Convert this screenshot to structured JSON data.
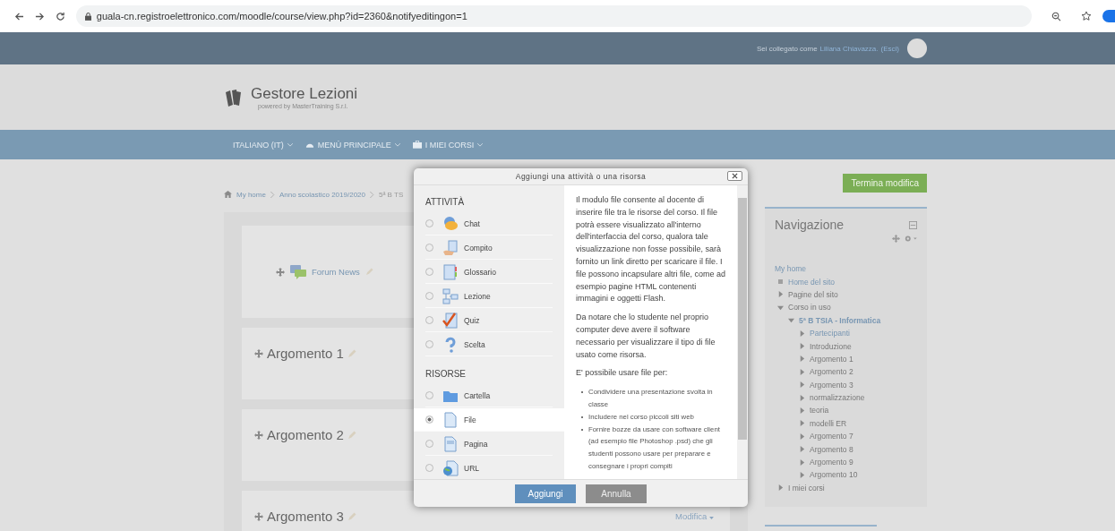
{
  "browser": {
    "url": "guala-cn.registroelettronico.com/moodle/course/view.php?id=2360&notifyeditingon=1"
  },
  "top_bar": {
    "prefix": "Sei collegato come",
    "user": "Liliana Chiavazza.",
    "logout": "(Esci)"
  },
  "logo": {
    "title": "Gestore Lezioni",
    "subtitle": "powered by MasterTraining S.r.l."
  },
  "menu": [
    {
      "kind": "language",
      "label": "ITALIANO (IT)"
    },
    {
      "kind": "dashboard",
      "label": "MENÙ PRINCIPALE"
    },
    {
      "kind": "courses",
      "label": "I MIEI CORSI"
    }
  ],
  "breadcrumb": [
    "My home",
    "Anno scolastico 2019/2020",
    "5ª B TS"
  ],
  "forum": {
    "label": "Forum News"
  },
  "sections": [
    {
      "title": "Argomento 1"
    },
    {
      "title": "Argomento 2"
    },
    {
      "title": "Argomento 3",
      "edit_menu": "Modifica"
    }
  ],
  "edit_button": "Termina modifica",
  "navigation": {
    "title": "Navigazione",
    "tree": [
      {
        "label": "My home",
        "link": true,
        "children": [
          {
            "label": "Home del sito",
            "link": true
          },
          {
            "label": "Pagine del sito",
            "link": false,
            "expanded": false
          },
          {
            "label": "Corso in uso",
            "link": false,
            "expanded": true,
            "children": [
              {
                "label": "5ª B TSIA - Informatica",
                "link": true,
                "bold": true,
                "expanded": true,
                "children": [
                  {
                    "label": "Partecipanti",
                    "link": true,
                    "expanded": false
                  },
                  {
                    "label": "Introduzione",
                    "link": false,
                    "expanded": false
                  },
                  {
                    "label": "Argomento 1",
                    "link": false,
                    "expanded": false
                  },
                  {
                    "label": "Argomento 2",
                    "link": false,
                    "expanded": false
                  },
                  {
                    "label": "Argomento 3",
                    "link": false,
                    "expanded": false
                  },
                  {
                    "label": "normalizzazione",
                    "link": false,
                    "expanded": false
                  },
                  {
                    "label": "teoria",
                    "link": false,
                    "expanded": false
                  },
                  {
                    "label": "modelli ER",
                    "link": false,
                    "expanded": false
                  },
                  {
                    "label": "Argomento 7",
                    "link": false,
                    "expanded": false
                  },
                  {
                    "label": "Argomento 8",
                    "link": false,
                    "expanded": false
                  },
                  {
                    "label": "Argomento 9",
                    "link": false,
                    "expanded": false
                  },
                  {
                    "label": "Argomento 10",
                    "link": false,
                    "expanded": false
                  }
                ]
              }
            ]
          },
          {
            "label": "I miei corsi",
            "link": false,
            "expanded": false
          }
        ]
      }
    ]
  },
  "dialog": {
    "title": "Aggiungi una attività o una risorsa",
    "groups": [
      {
        "heading": "ATTIVITÀ",
        "options": [
          {
            "kind": "chat",
            "label": "Chat",
            "selected": false
          },
          {
            "kind": "assignment",
            "label": "Compito",
            "selected": false
          },
          {
            "kind": "glossary",
            "label": "Glossario",
            "selected": false
          },
          {
            "kind": "lesson",
            "label": "Lezione",
            "selected": false
          },
          {
            "kind": "quiz",
            "label": "Quiz",
            "selected": false
          },
          {
            "kind": "choice",
            "label": "Scelta",
            "selected": false
          }
        ]
      },
      {
        "heading": "RISORSE",
        "options": [
          {
            "kind": "folder",
            "label": "Cartella",
            "selected": false
          },
          {
            "kind": "file",
            "label": "File",
            "selected": true
          },
          {
            "kind": "page",
            "label": "Pagina",
            "selected": false
          },
          {
            "kind": "url",
            "label": "URL",
            "selected": false
          }
        ]
      }
    ],
    "paragraphs": [
      "Il modulo file consente al docente di inserire file tra le risorse del corso. Il file potrà essere visualizzato all'interno dell'interfaccia del corso, qualora tale visualizzazione non fosse possibile, sarà fornito un link diretto per scaricare il file. I file possono incapsulare altri file, come ad esempio pagine HTML contenenti immagini e oggetti Flash.",
      "Da notare che lo studente nel proprio computer deve avere il software necessario per visualizzare il tipo di file usato come risorsa.",
      "E' possibile usare file per:"
    ],
    "bullets": [
      "Condividere una presentazione svolta in classe",
      "Includere nel corso piccoli siti web",
      "Fornire bozze da usare con software client (ad esempio file Photoshop .psd) che gli studenti possono usare per preparare e consegnare i propri compiti"
    ],
    "buttons": [
      {
        "kind": "primary",
        "label": "Aggiungi"
      },
      {
        "kind": "secondary",
        "label": "Annulla"
      }
    ]
  }
}
